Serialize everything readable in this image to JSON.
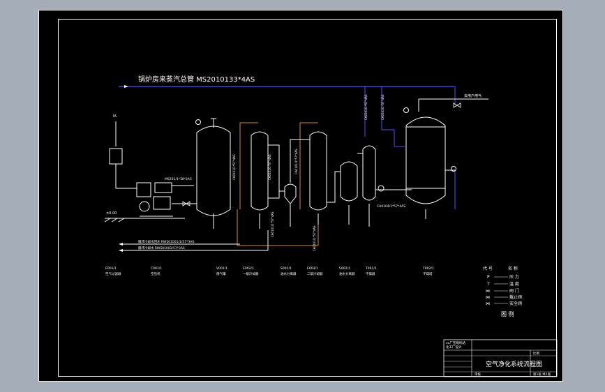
{
  "drawing": {
    "main_pipe_label": "锅炉房来蒸汽总管 MS2010133*4AS",
    "title_block": {
      "company_line1": "xx厂压缩机站",
      "company_line2": "化工厂设计",
      "scale_label": "比例",
      "diagram_title": "空气净化系统流程图",
      "sheet_label": "第1张 共1张",
      "sign_label": "审核"
    },
    "legend": {
      "header_code": "代 号",
      "header_name": "名 称",
      "items": [
        {
          "code": "P",
          "name": "压 力"
        },
        {
          "code": "T",
          "name": "温 度"
        },
        {
          "code": "⋈",
          "name": "阀 门"
        },
        {
          "code": "⋈",
          "name": "截止阀"
        },
        {
          "code": "⋈",
          "name": "安全阀"
        }
      ],
      "title": "图 例"
    },
    "equipment_labels": [
      {
        "line1": "E001/1",
        "line2": "空气过滤器"
      },
      {
        "line1": "C001/1",
        "line2": "空压机"
      },
      {
        "line1": "V001/1",
        "line2": "储气罐"
      },
      {
        "line1": "E002/1",
        "line2": "一级冷却器"
      },
      {
        "line1": "S001/1",
        "line2": "油水分离器"
      },
      {
        "line1": "E003/1",
        "line2": "二级冷却器"
      },
      {
        "line1": "S002/1",
        "line2": "油水分离器"
      },
      {
        "line1": "T001/1",
        "line2": "干燥器"
      },
      {
        "line1": "T002/1",
        "line2": "干燥塔"
      }
    ],
    "pipe_labels": {
      "to_user": "去用户用气",
      "cooling_water_return": "循环冷却水回水 RW501001/1/57*3AS",
      "cooling_water_supply": "循环冷却水 RWS01001/57*3AS",
      "air_pipe": "CA0101/1*57*4AS",
      "air_outlet": "CA0104/1*57*4AS",
      "steam_branch": "MS201/1*38*3AS",
      "vent": "IA",
      "ground": "±0.00"
    }
  }
}
